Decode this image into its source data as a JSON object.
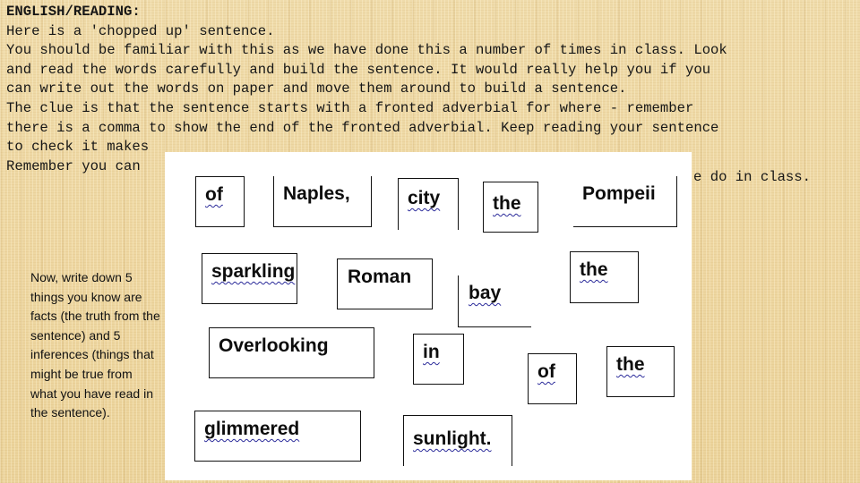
{
  "instructions": {
    "heading": "ENGLISH/READING:",
    "lines": [
      "Here is a 'chopped up' sentence.",
      "You should be familiar with this as we have done this a number of times in class. Look",
      "and read the words carefully and build the sentence. It would really help you if you",
      "can write out the words on paper and move them around to build a sentence.",
      "The clue is that the sentence starts with a fronted adverbial for where - remember",
      "there is a comma to show the end of the fronted adverbial. Keep reading your sentence",
      "to check it makes",
      "Remember you can"
    ],
    "obscured_tail": "e do in class."
  },
  "side_note": {
    "text": "Now, write down 5 things you know are facts (the truth from the sentence) and 5 inferences (things that might be true from what you have read in the sentence)."
  },
  "word_cards": [
    {
      "word": "of",
      "spell_flag": true
    },
    {
      "word": "Naples,",
      "spell_flag": false
    },
    {
      "word": "city",
      "spell_flag": true
    },
    {
      "word": "the",
      "spell_flag": true
    },
    {
      "word": "Pompeii",
      "spell_flag": false
    },
    {
      "word": "sparkling",
      "spell_flag": true
    },
    {
      "word": "Roman",
      "spell_flag": false
    },
    {
      "word": "bay",
      "spell_flag": true
    },
    {
      "word": "the",
      "spell_flag": true
    },
    {
      "word": "Overlooking",
      "spell_flag": false
    },
    {
      "word": "in",
      "spell_flag": true
    },
    {
      "word": "of",
      "spell_flag": true
    },
    {
      "word": "the",
      "spell_flag": true
    },
    {
      "word": "glimmered",
      "spell_flag": true
    },
    {
      "word": "sunlight.",
      "spell_flag": true
    }
  ]
}
